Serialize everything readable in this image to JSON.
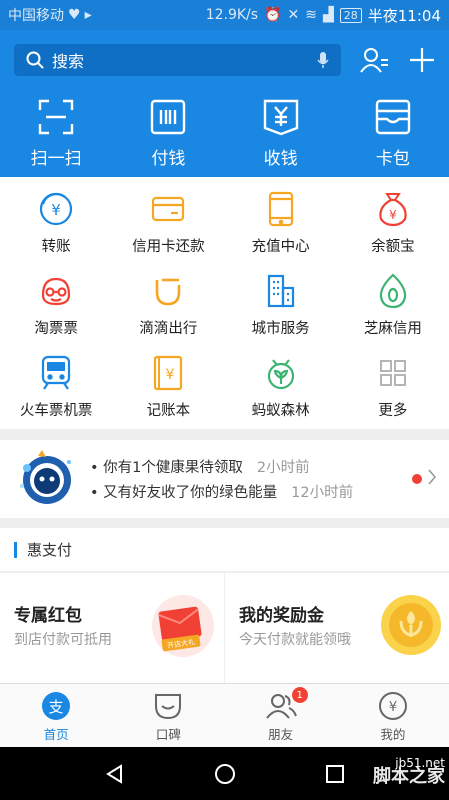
{
  "status_bar": {
    "carrier": "中国移动",
    "speed": "12.9K/s",
    "battery": "28",
    "time": "半夜11:04"
  },
  "header": {
    "search_placeholder": "搜索",
    "quick_actions": [
      {
        "label": "扫一扫",
        "icon": "scan-icon"
      },
      {
        "label": "付钱",
        "icon": "barcode-icon"
      },
      {
        "label": "收钱",
        "icon": "receive-money-icon"
      },
      {
        "label": "卡包",
        "icon": "card-wallet-icon"
      }
    ]
  },
  "grid": [
    {
      "label": "转账",
      "icon": "transfer-icon"
    },
    {
      "label": "信用卡还款",
      "icon": "credit-card-icon"
    },
    {
      "label": "充值中心",
      "icon": "phone-recharge-icon"
    },
    {
      "label": "余额宝",
      "icon": "money-bag-icon"
    },
    {
      "label": "淘票票",
      "icon": "ticket-mascot-icon"
    },
    {
      "label": "滴滴出行",
      "icon": "didi-icon"
    },
    {
      "label": "城市服务",
      "icon": "city-building-icon"
    },
    {
      "label": "芝麻信用",
      "icon": "sesame-credit-icon"
    },
    {
      "label": "火车票机票",
      "icon": "train-icon"
    },
    {
      "label": "记账本",
      "icon": "account-book-icon"
    },
    {
      "label": "蚂蚁森林",
      "icon": "ant-forest-icon"
    },
    {
      "label": "更多",
      "icon": "more-grid-icon"
    }
  ],
  "notice": {
    "line1": "• 你有1个健康果待领取",
    "line1_time": "2小时前",
    "line2": "• 又有好友收了你的绿色能量",
    "line2_time": "12小时前"
  },
  "huizhifu": {
    "title": "惠支付",
    "cards": [
      {
        "title": "专属红包",
        "subtitle": "到店付款可抵用",
        "image_text": "开店大礼"
      },
      {
        "title": "我的奖励金",
        "subtitle": "今天付款就能领哦"
      }
    ]
  },
  "tabbar": {
    "tabs": [
      {
        "label": "首页",
        "icon": "home-alipay-icon",
        "active": true
      },
      {
        "label": "口碑",
        "icon": "koubei-icon"
      },
      {
        "label": "朋友",
        "icon": "friends-icon",
        "badge": "1"
      },
      {
        "label": "我的",
        "icon": "my-yuan-icon"
      }
    ]
  },
  "watermark": {
    "site": "jb51.net",
    "name": "脚本之家"
  },
  "colors": {
    "primary": "#1a87e2",
    "status_bar": "#1a7fd6",
    "orange": "#f5a623",
    "red": "#f04134",
    "green": "#3cb371"
  }
}
